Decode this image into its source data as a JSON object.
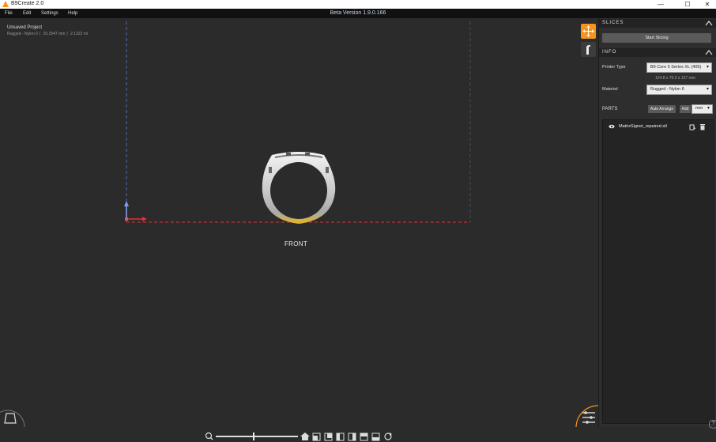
{
  "window": {
    "title": "B9Create 2.0",
    "version": "Beta Version 1.9.0.166",
    "controls": {
      "minimize": "—",
      "maximize": "☐",
      "close": "✕"
    }
  },
  "menu": [
    "File",
    "Edit",
    "Settings",
    "Help"
  ],
  "project": {
    "name": "Unsaved Project",
    "material": "Rugged - Nylon 6",
    "size": "25.2547 mm",
    "volume": "2.1322 ml"
  },
  "viewport": {
    "view_label": "FRONT"
  },
  "colors": {
    "accent": "#f7941d",
    "axis_red": "#e0303a",
    "axis_blue": "#5a78d8"
  },
  "panel": {
    "slices": {
      "title": "SLICES",
      "start_button": "Start Slicing"
    },
    "info": {
      "title": "INFO",
      "printer_label": "Printer Type",
      "printer_value": "B9 Core 5 Series XL (405)",
      "dimensions": "124.8 x 70.2 x 127 mm",
      "material_label": "Material",
      "material_value": "Rugged - Nylon 6"
    },
    "parts": {
      "title": "PARTS",
      "auto_arrange": "Auto Arrange",
      "add": "Add",
      "unit": "mm",
      "items": [
        {
          "name": "MatrixSignet_repaired.stl"
        }
      ]
    }
  },
  "bottom_toolbar": {
    "icons": [
      "zoom-icon",
      "home-view-icon",
      "front-view-icon",
      "back-view-icon",
      "left-view-icon",
      "right-view-icon",
      "top-view-icon",
      "bottom-view-icon",
      "iso-view-icon"
    ],
    "zoom_level": 0.45
  }
}
